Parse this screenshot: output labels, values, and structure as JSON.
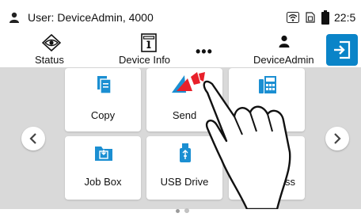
{
  "colors": {
    "accent": "#0a84c8",
    "background_panel": "#d9d9d9",
    "send_icon_red": "#e8202a",
    "send_icon_blue": "#1b8fd2"
  },
  "status_bar": {
    "user_text": "User: DeviceAdmin, 4000",
    "clock": "22:5",
    "icons": [
      "user-icon",
      "wifi-icon",
      "sim-card-icon",
      "battery-icon"
    ]
  },
  "toolbar": {
    "status_label": "Status",
    "device_info_label": "Device Info",
    "more_label": "•••",
    "device_admin_label": "DeviceAdmin",
    "logout_icon": "logout-icon"
  },
  "tiles": [
    {
      "label": "Copy",
      "icon": "copy-icon"
    },
    {
      "label": "Send",
      "icon": "send-icon"
    },
    {
      "label": "Fax",
      "icon": "fax-icon"
    },
    {
      "label": "Job Box",
      "icon": "job-box-icon"
    },
    {
      "label": "USB Drive",
      "icon": "usb-drive-icon"
    },
    {
      "label": "ss",
      "icon": "address-book-icon"
    }
  ],
  "pagination": {
    "current_page": 1,
    "total_pages": 2
  }
}
